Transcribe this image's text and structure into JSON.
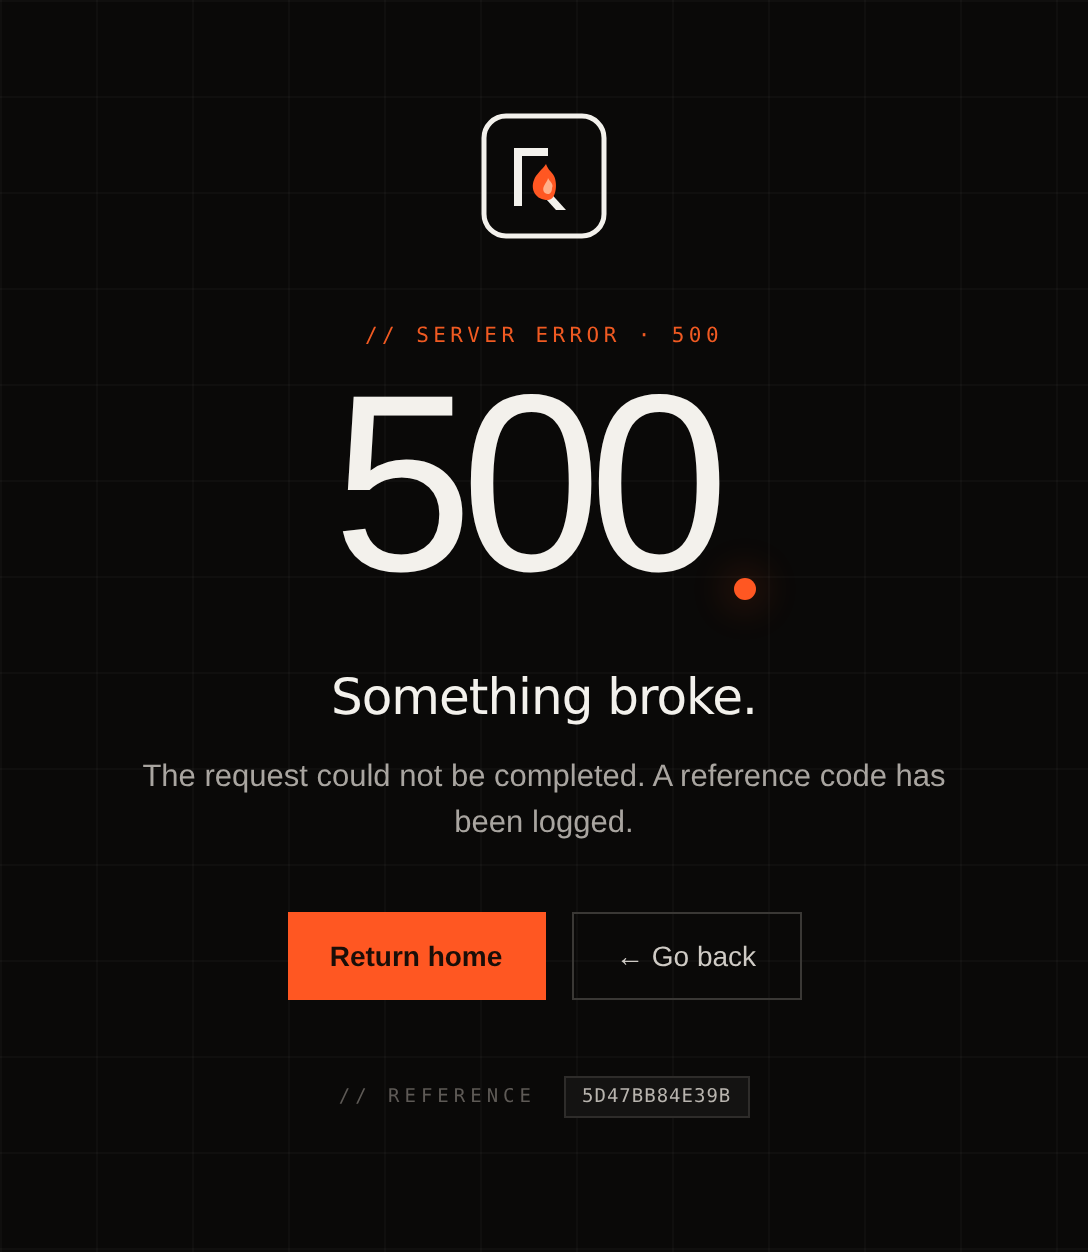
{
  "eyebrow": "// SERVER ERROR · 500",
  "code": "500",
  "heading": "Something broke.",
  "message": "The request could not be completed. A reference code has been logged.",
  "buttons": [
    {
      "label": "Return home",
      "kind": "primary"
    },
    {
      "label": "← Go back",
      "kind": "secondary"
    }
  ],
  "reference": {
    "label": "// REFERENCE",
    "value": "5D47BB84E39B"
  }
}
